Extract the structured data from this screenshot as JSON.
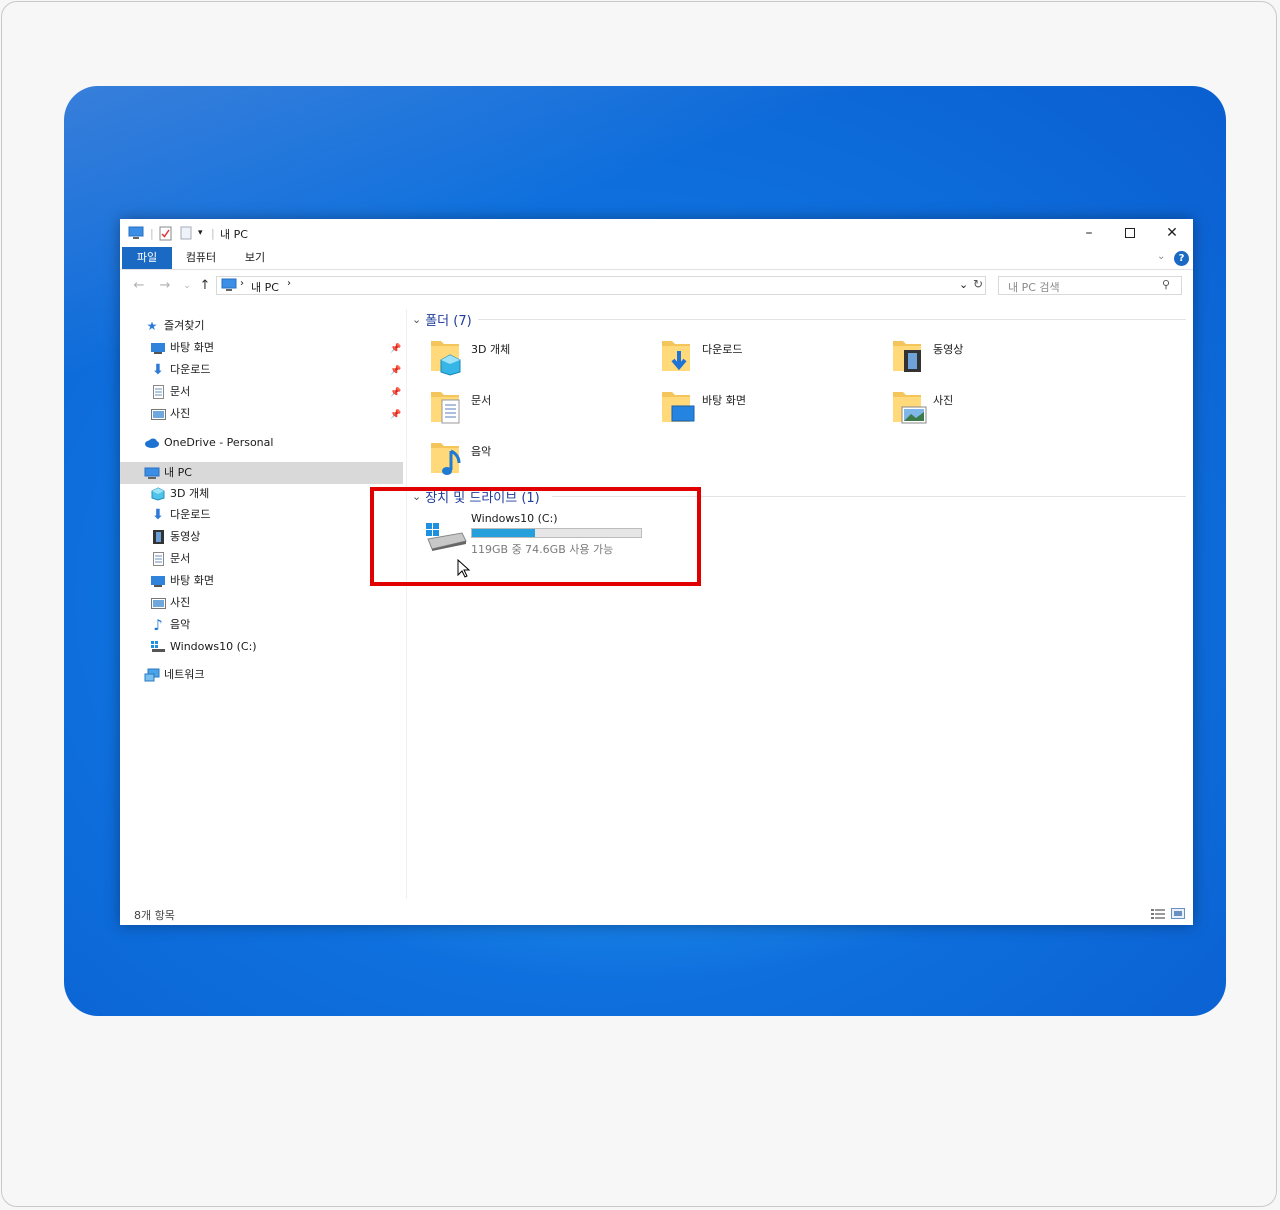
{
  "window": {
    "title": "내 PC",
    "ribbon_tabs": [
      "파일",
      "컴퓨터",
      "보기"
    ]
  },
  "address": {
    "path_item": "내 PC",
    "search_placeholder": "내 PC 검색"
  },
  "sidebar": {
    "quick_access": "즐겨찾기",
    "quick_items": [
      "바탕 화면",
      "다운로드",
      "문서",
      "사진"
    ],
    "onedrive": "OneDrive - Personal",
    "this_pc": "내 PC",
    "pc_items": [
      "3D 개체",
      "다운로드",
      "동영상",
      "문서",
      "바탕 화면",
      "사진",
      "음악",
      "Windows10 (C:)"
    ],
    "network": "네트워크"
  },
  "folders": {
    "header": "폴더 (7)",
    "items": [
      "3D 개체",
      "다운로드",
      "동영상",
      "문서",
      "바탕 화면",
      "사진",
      "음악"
    ]
  },
  "drives": {
    "header": "장치 및 드라이브 (1)",
    "drive_name": "Windows10 (C:)",
    "usage_text": "119GB 중 74.6GB 사용 가능",
    "used_fraction": 0.37
  },
  "status": {
    "item_count": "8개 항목"
  },
  "colors": {
    "accent": "#1a6ac4",
    "highlight_box": "#e00000",
    "drive_bar": "#26a0da",
    "group_header": "#1e3d9a"
  }
}
